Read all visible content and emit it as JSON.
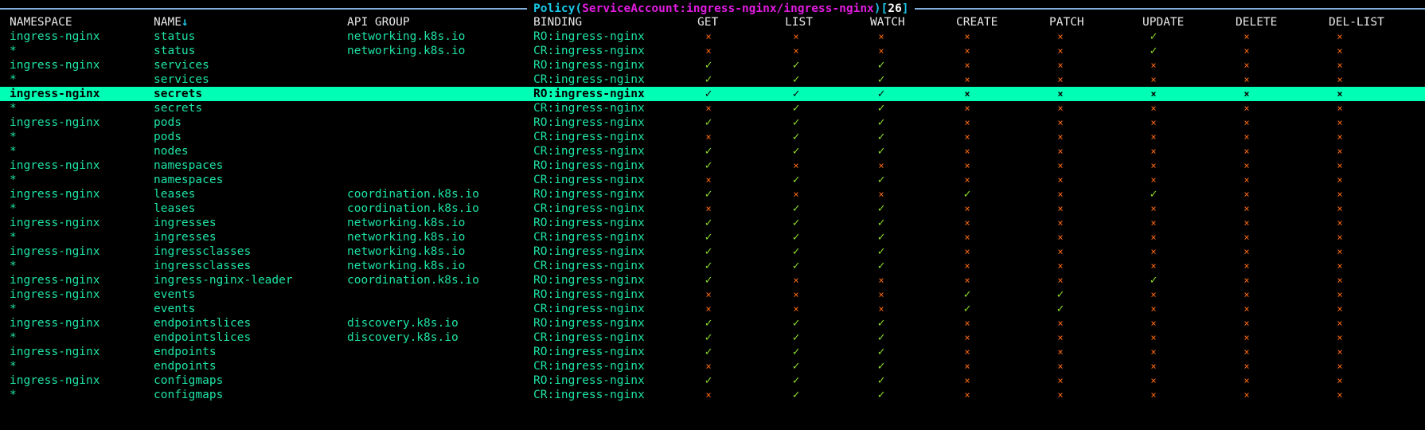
{
  "title": {
    "kind": "Policy",
    "subject": "ServiceAccount:ingress-nginx/ingress-nginx",
    "count": "26"
  },
  "columns": {
    "namespace": "NAMESPACE",
    "name": "NAME",
    "sort_indicator": "↓",
    "api_group": "API GROUP",
    "binding": "BINDING",
    "get": "GET",
    "list": "LIST",
    "watch": "WATCH",
    "create": "CREATE",
    "patch": "PATCH",
    "update": "UPDATE",
    "delete": "DELETE",
    "del_list": "DEL-LIST"
  },
  "symbols": {
    "allowed": "✓",
    "denied": "×"
  },
  "colors": {
    "allowed": "#8de02a",
    "denied": "#ff6a10",
    "text": "#1ee3a5",
    "selected_bg": "#00ffb5",
    "title_sa": "#e11de0",
    "title_accent": "#1ac8e8"
  },
  "selected_row": 4,
  "rows": [
    {
      "ns": "ingress-nginx",
      "name": "status",
      "api": "networking.k8s.io",
      "binding": "RO:ingress-nginx",
      "perms": [
        0,
        0,
        0,
        0,
        0,
        1,
        0,
        0
      ]
    },
    {
      "ns": "*",
      "name": "status",
      "api": "networking.k8s.io",
      "binding": "CR:ingress-nginx",
      "perms": [
        0,
        0,
        0,
        0,
        0,
        1,
        0,
        0
      ]
    },
    {
      "ns": "ingress-nginx",
      "name": "services",
      "api": "",
      "binding": "RO:ingress-nginx",
      "perms": [
        1,
        1,
        1,
        0,
        0,
        0,
        0,
        0
      ]
    },
    {
      "ns": "*",
      "name": "services",
      "api": "",
      "binding": "CR:ingress-nginx",
      "perms": [
        1,
        1,
        1,
        0,
        0,
        0,
        0,
        0
      ]
    },
    {
      "ns": "ingress-nginx",
      "name": "secrets",
      "api": "",
      "binding": "RO:ingress-nginx",
      "perms": [
        1,
        1,
        1,
        0,
        0,
        0,
        0,
        0
      ]
    },
    {
      "ns": "*",
      "name": "secrets",
      "api": "",
      "binding": "CR:ingress-nginx",
      "perms": [
        0,
        1,
        1,
        0,
        0,
        0,
        0,
        0
      ]
    },
    {
      "ns": "ingress-nginx",
      "name": "pods",
      "api": "",
      "binding": "RO:ingress-nginx",
      "perms": [
        1,
        1,
        1,
        0,
        0,
        0,
        0,
        0
      ]
    },
    {
      "ns": "*",
      "name": "pods",
      "api": "",
      "binding": "CR:ingress-nginx",
      "perms": [
        0,
        1,
        1,
        0,
        0,
        0,
        0,
        0
      ]
    },
    {
      "ns": "*",
      "name": "nodes",
      "api": "",
      "binding": "CR:ingress-nginx",
      "perms": [
        1,
        1,
        1,
        0,
        0,
        0,
        0,
        0
      ]
    },
    {
      "ns": "ingress-nginx",
      "name": "namespaces",
      "api": "",
      "binding": "RO:ingress-nginx",
      "perms": [
        1,
        0,
        0,
        0,
        0,
        0,
        0,
        0
      ]
    },
    {
      "ns": "*",
      "name": "namespaces",
      "api": "",
      "binding": "CR:ingress-nginx",
      "perms": [
        0,
        1,
        1,
        0,
        0,
        0,
        0,
        0
      ]
    },
    {
      "ns": "ingress-nginx",
      "name": "leases",
      "api": "coordination.k8s.io",
      "binding": "RO:ingress-nginx",
      "perms": [
        1,
        0,
        0,
        1,
        0,
        1,
        0,
        0
      ]
    },
    {
      "ns": "*",
      "name": "leases",
      "api": "coordination.k8s.io",
      "binding": "CR:ingress-nginx",
      "perms": [
        0,
        1,
        1,
        0,
        0,
        0,
        0,
        0
      ]
    },
    {
      "ns": "ingress-nginx",
      "name": "ingresses",
      "api": "networking.k8s.io",
      "binding": "RO:ingress-nginx",
      "perms": [
        1,
        1,
        1,
        0,
        0,
        0,
        0,
        0
      ]
    },
    {
      "ns": "*",
      "name": "ingresses",
      "api": "networking.k8s.io",
      "binding": "CR:ingress-nginx",
      "perms": [
        1,
        1,
        1,
        0,
        0,
        0,
        0,
        0
      ]
    },
    {
      "ns": "ingress-nginx",
      "name": "ingressclasses",
      "api": "networking.k8s.io",
      "binding": "RO:ingress-nginx",
      "perms": [
        1,
        1,
        1,
        0,
        0,
        0,
        0,
        0
      ]
    },
    {
      "ns": "*",
      "name": "ingressclasses",
      "api": "networking.k8s.io",
      "binding": "CR:ingress-nginx",
      "perms": [
        1,
        1,
        1,
        0,
        0,
        0,
        0,
        0
      ]
    },
    {
      "ns": "ingress-nginx",
      "name": "ingress-nginx-leader",
      "api": "coordination.k8s.io",
      "binding": "RO:ingress-nginx",
      "perms": [
        1,
        0,
        0,
        0,
        0,
        1,
        0,
        0
      ]
    },
    {
      "ns": "ingress-nginx",
      "name": "events",
      "api": "",
      "binding": "RO:ingress-nginx",
      "perms": [
        0,
        0,
        0,
        1,
        1,
        0,
        0,
        0
      ]
    },
    {
      "ns": "*",
      "name": "events",
      "api": "",
      "binding": "CR:ingress-nginx",
      "perms": [
        0,
        0,
        0,
        1,
        1,
        0,
        0,
        0
      ]
    },
    {
      "ns": "ingress-nginx",
      "name": "endpointslices",
      "api": "discovery.k8s.io",
      "binding": "RO:ingress-nginx",
      "perms": [
        1,
        1,
        1,
        0,
        0,
        0,
        0,
        0
      ]
    },
    {
      "ns": "*",
      "name": "endpointslices",
      "api": "discovery.k8s.io",
      "binding": "CR:ingress-nginx",
      "perms": [
        1,
        1,
        1,
        0,
        0,
        0,
        0,
        0
      ]
    },
    {
      "ns": "ingress-nginx",
      "name": "endpoints",
      "api": "",
      "binding": "RO:ingress-nginx",
      "perms": [
        1,
        1,
        1,
        0,
        0,
        0,
        0,
        0
      ]
    },
    {
      "ns": "*",
      "name": "endpoints",
      "api": "",
      "binding": "CR:ingress-nginx",
      "perms": [
        0,
        1,
        1,
        0,
        0,
        0,
        0,
        0
      ]
    },
    {
      "ns": "ingress-nginx",
      "name": "configmaps",
      "api": "",
      "binding": "RO:ingress-nginx",
      "perms": [
        1,
        1,
        1,
        0,
        0,
        0,
        0,
        0
      ]
    },
    {
      "ns": "*",
      "name": "configmaps",
      "api": "",
      "binding": "CR:ingress-nginx",
      "perms": [
        0,
        1,
        1,
        0,
        0,
        0,
        0,
        0
      ]
    }
  ]
}
